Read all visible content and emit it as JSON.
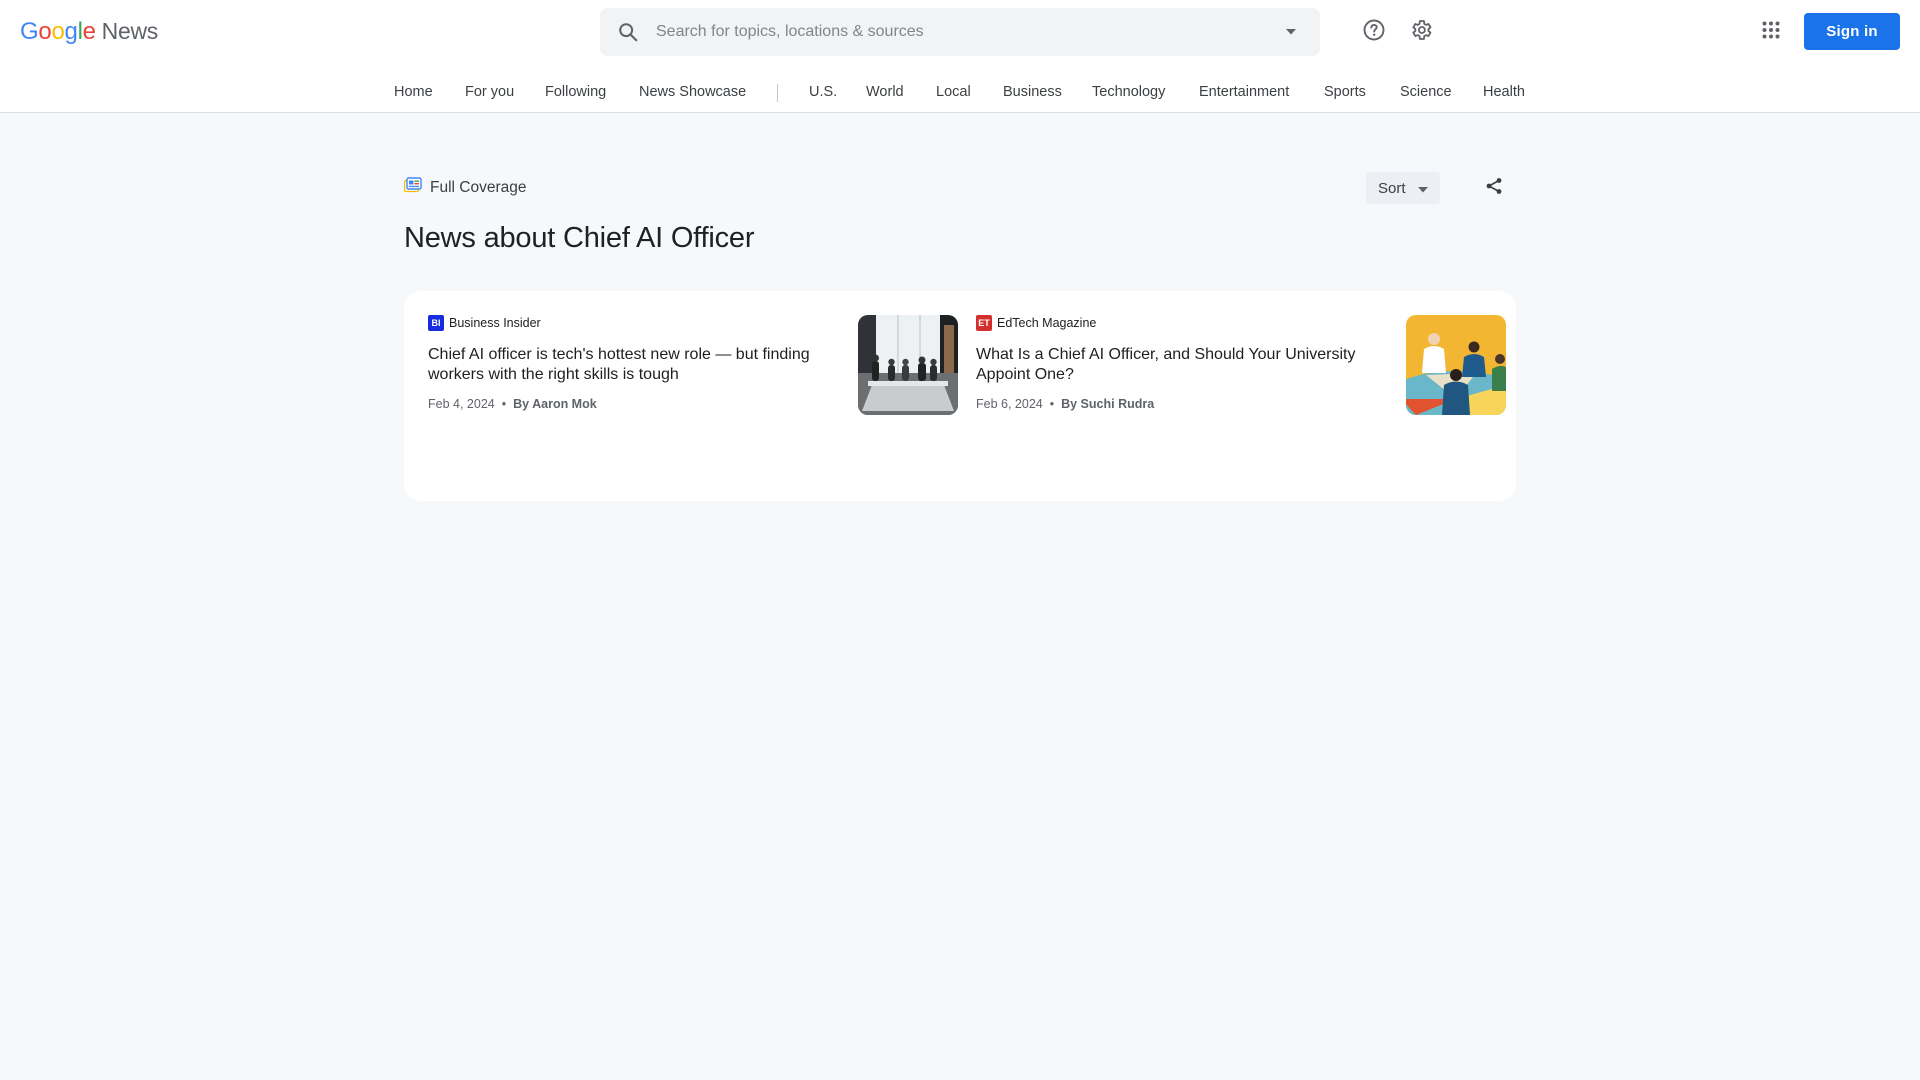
{
  "header": {
    "logo": {
      "google": [
        "G",
        "o",
        "o",
        "g",
        "l",
        "e"
      ],
      "news": "News"
    },
    "search": {
      "placeholder": "Search for topics, locations & sources"
    },
    "signin_label": "Sign in"
  },
  "nav": {
    "items": [
      "Home",
      "For you",
      "Following",
      "News Showcase",
      "U.S.",
      "World",
      "Local",
      "Business",
      "Technology",
      "Entertainment",
      "Sports",
      "Science",
      "Health"
    ]
  },
  "main": {
    "full_coverage_label": "Full Coverage",
    "sort_label": "Sort",
    "title": "News about Chief AI Officer",
    "articles": [
      {
        "source": "Business Insider",
        "source_logo": "BI",
        "headline": "Chief AI officer is tech's hottest new role — but finding workers with the right skills is tough",
        "date": "Feb 4, 2024",
        "byline": "By Aaron Mok"
      },
      {
        "source": "EdTech Magazine",
        "source_logo": "ET",
        "headline": "What Is a Chief AI Officer, and Should Your University Appoint One?",
        "date": "Feb 6, 2024",
        "byline": "By Suchi Rudra"
      }
    ]
  },
  "colors": {
    "accent": "#1a73e8",
    "google_blue": "#4285f4",
    "google_red": "#ea4335",
    "google_yellow": "#fbbc05",
    "google_green": "#34a853",
    "background": "#f6f8fc"
  },
  "icons": [
    "search-icon",
    "chevron-down-icon",
    "help-icon",
    "gear-icon",
    "apps-grid-icon",
    "full-coverage-icon",
    "share-icon"
  ]
}
